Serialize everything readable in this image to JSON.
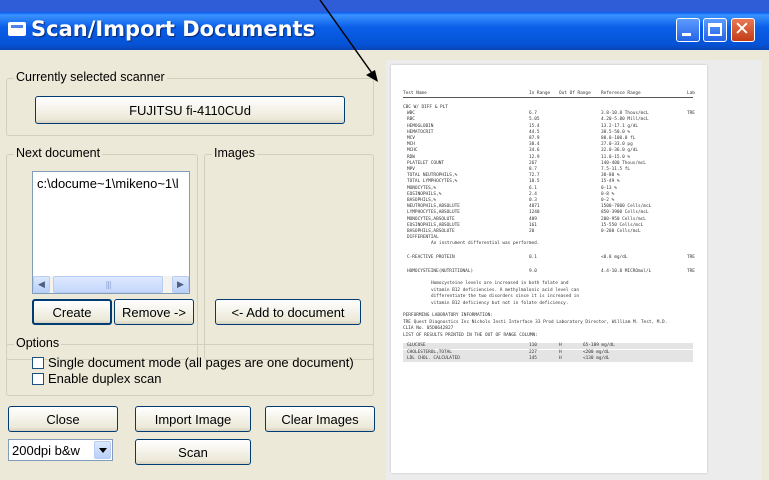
{
  "window": {
    "title": "Scan/Import Documents",
    "minimize_label": "",
    "maximize_label": "",
    "close_glyph": "✕"
  },
  "scanner_group": {
    "label": "Currently selected scanner",
    "scanner_button": "FUJITSU fi-4110CUd"
  },
  "next_document_group": {
    "label": "Next document",
    "items": [
      "c:\\docume~1\\mikeno~1\\l"
    ],
    "create_button": "Create",
    "remove_button": "Remove ->"
  },
  "images_group": {
    "label": "Images",
    "add_button": "<- Add to document"
  },
  "options_group": {
    "label": "Options",
    "single_document_mode": {
      "label": "Single document mode (all pages are one document)",
      "checked": false
    },
    "enable_duplex": {
      "label": "Enable duplex scan",
      "checked": false
    }
  },
  "actions": {
    "close": "Close",
    "import_image": "Import Image",
    "clear_images": "Clear Images",
    "resolution": "200dpi b&w",
    "scan": "Scan"
  },
  "preview": {
    "header": [
      "Test Name",
      "In Range",
      "Out Of Range",
      "Reference Range",
      "Lab"
    ],
    "rows": [
      [
        "CBC W/ DIFF & PLT",
        "",
        "",
        "",
        ""
      ],
      [
        "WBC",
        "6.7",
        "",
        "3.8-10.8 Thous/mcL",
        "TRE"
      ],
      [
        "RBC",
        "5.05",
        "",
        "4.20-5.80 Mill/mcL",
        ""
      ],
      [
        "HEMOGLOBIN",
        "15.4",
        "",
        "13.2-17.1 g/dL",
        ""
      ],
      [
        "HEMATOCRIT",
        "44.5",
        "",
        "38.5-50.0 %",
        ""
      ],
      [
        "MCV",
        "87.9",
        "",
        "80.0-100.0 fL",
        ""
      ],
      [
        "MCH",
        "30.4",
        "",
        "27.0-33.0 pg",
        ""
      ],
      [
        "MCHC",
        "34.6",
        "",
        "32.0-36.0 g/dL",
        ""
      ],
      [
        "RDW",
        "12.9",
        "",
        "11.0-15.0 %",
        ""
      ],
      [
        "PLATELET COUNT",
        "267",
        "",
        "140-400 Thous/mcL",
        ""
      ],
      [
        "MPV",
        "8.7",
        "",
        "7.5-11.5 fL",
        ""
      ],
      [
        "TOTAL NEUTROPHILS,%",
        "72.7",
        "",
        "38-80 %",
        ""
      ],
      [
        "TOTAL LYMPHOCYTES,%",
        "18.5",
        "",
        "15-49 %",
        ""
      ],
      [
        "MONOCYTES,%",
        "6.1",
        "",
        "0-13 %",
        ""
      ],
      [
        "EOSINOPHILS,%",
        "2.4",
        "",
        "0-8 %",
        ""
      ],
      [
        "BASOPHILS,%",
        "0.3",
        "",
        "0-2 %",
        ""
      ],
      [
        "NEUTROPHILS,ABSOLUTE",
        "4871",
        "",
        "1500-7800 Cells/mcL",
        ""
      ],
      [
        "LYMPHOCYTES,ABSOLUTE",
        "1240",
        "",
        "850-3900 Cells/mcL",
        ""
      ],
      [
        "MONOCYTES,ABSOLUTE",
        "409",
        "",
        "200-950 Cells/mcL",
        ""
      ],
      [
        "EOSINOPHILS,ABSOLUTE",
        "161",
        "",
        "15-550 Cells/mcL",
        ""
      ],
      [
        "BASOPHILS,ABSOLUTE",
        "20",
        "",
        "0-200 Cells/mcL",
        ""
      ],
      [
        "DIFFERENTIAL",
        "",
        "",
        "",
        ""
      ]
    ],
    "diff_note": "An instrument differential was performed.",
    "crp_row": [
      "C-REACTIVE PROTEIN",
      "0.1",
      "",
      "<0.8 mg/dL",
      "TRE"
    ],
    "homocysteine_row": [
      "HOMOCYSTEINE(NUTRITIONAL)",
      "9.0",
      "",
      "4.4-10.8 MICROmol/L",
      "TRE"
    ],
    "note_lines": [
      "Homocysteine levels are increased in both folate and",
      "vitamin B12 deficiencies. A methylmalonic acid level can",
      "differentiate the two disorders since it is increased in",
      "vitamin B12 deficiency but not in folate deficiency."
    ],
    "lab_info_lines": [
      "PERFORMING LABORATORY INFORMATION:",
      "TRE  Quest Diagnostics Inc Nichols Insti Interface 33 Prod Laboratory Director, William M. Test, M.D.",
      "      CLIA No. 05D0642827",
      "LIST OF RESULTS PRINTED IN THE OUT OF RANGE COLUMN:"
    ],
    "out_of_range_rows": [
      [
        "GLUCOSE",
        "110",
        "H",
        "65-109 mg/dL"
      ],
      [
        "CHOLESTEROL,TOTAL",
        "227",
        "H",
        "<200 mg/dL"
      ],
      [
        "LDL CHOL. CALCULATED",
        "145",
        "H",
        "<130 mg/dL"
      ]
    ]
  }
}
